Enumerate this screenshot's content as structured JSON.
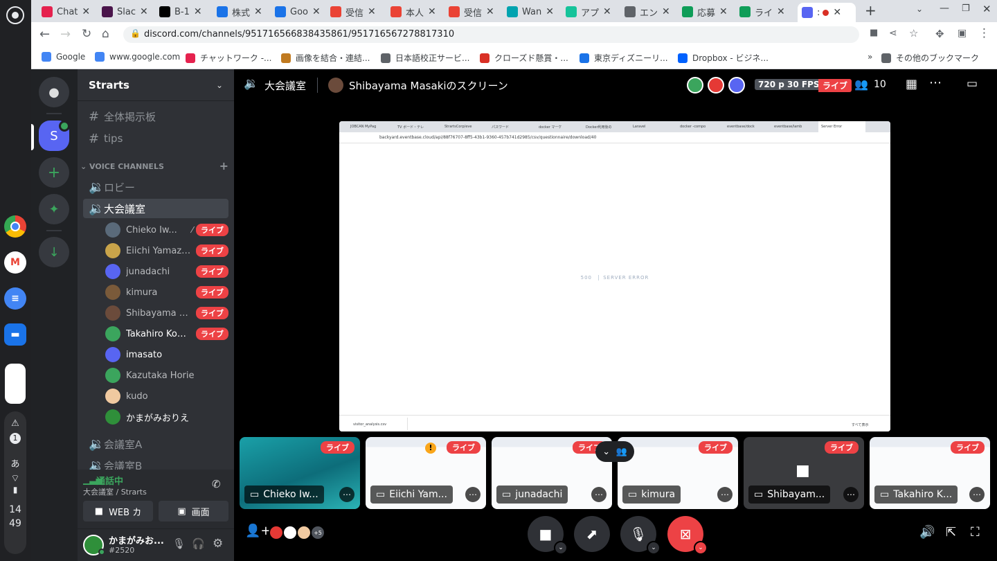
{
  "browser": {
    "tabs": [
      {
        "label": "Chat",
        "icon": "chatwork-icon",
        "color": "#e5224e"
      },
      {
        "label": "Slac",
        "icon": "slack-icon",
        "color": "#4a154b"
      },
      {
        "label": "B-1",
        "icon": "notion-icon",
        "color": "#000000"
      },
      {
        "label": "株式",
        "icon": "calendar-icon",
        "color": "#1a73e8"
      },
      {
        "label": "Goo",
        "icon": "calendar-icon",
        "color": "#1a73e8"
      },
      {
        "label": "受信",
        "icon": "gmail-icon",
        "color": "#ea4335"
      },
      {
        "label": "本人",
        "icon": "gmail-icon",
        "color": "#ea4335"
      },
      {
        "label": "受信",
        "icon": "gmail-icon",
        "color": "#ea4335"
      },
      {
        "label": "Wan",
        "icon": "w-icon",
        "color": "#00a3af"
      },
      {
        "label": "アプ",
        "icon": "grammarly-icon",
        "color": "#15c39a"
      },
      {
        "label": "エン",
        "icon": "globe-icon",
        "color": "#5f6368"
      },
      {
        "label": "応募",
        "icon": "sheets-icon",
        "color": "#0f9d58"
      },
      {
        "label": "ライ",
        "icon": "sheets-icon",
        "color": "#0f9d58"
      },
      {
        "label": ":",
        "icon": "discord-icon",
        "color": "#5865f2",
        "active": true
      }
    ],
    "url": "discord.com/channels/951716566838435861/951716567278817310",
    "bookmarks": [
      {
        "label": "Google",
        "icon": "google-icon"
      },
      {
        "label": "www.google.com",
        "icon": "google-icon"
      },
      {
        "label": "チャットワーク -...",
        "icon": "chatwork-icon"
      },
      {
        "label": "画像を結合・連結...",
        "icon": "image-icon"
      },
      {
        "label": "日本語校正サービ...",
        "icon": "globe-icon"
      },
      {
        "label": "クローズド懸賞・...",
        "icon": "prize-icon"
      },
      {
        "label": "東京ディズニーリ...",
        "icon": "disney-icon"
      },
      {
        "label": "Dropbox - ビジネ...",
        "icon": "dropbox-icon"
      }
    ],
    "other_bookmarks": "その他のブックマーク",
    "more_bookmarks": "»"
  },
  "shelf": {
    "time_hour": "14",
    "time_min": "49",
    "ime": "あ",
    "notif_count": "1"
  },
  "discord": {
    "server_name": "Strarts",
    "server_initial": "S",
    "text_channels": [
      "全体掲示板",
      "tips"
    ],
    "voice_header": "VOICE CHANNELS",
    "voice_channels": [
      {
        "name": "ロビー"
      },
      {
        "name": "大会議室",
        "active": true
      },
      {
        "name": "会議室A"
      },
      {
        "name": "会議室B"
      }
    ],
    "members": [
      {
        "name": "Chieko Iw...",
        "live": true,
        "deaf": true,
        "avatar": "#5a6a7a"
      },
      {
        "name": "Eiichi Yamazaki",
        "live": true,
        "avatar": "#c9a44a"
      },
      {
        "name": "junadachi",
        "live": true,
        "avatar": "#5865f2"
      },
      {
        "name": "kimura",
        "live": true,
        "avatar": "#7a5a3a"
      },
      {
        "name": "Shibayama M...",
        "live": true,
        "avatar": "#6b4b3b"
      },
      {
        "name": "Takahiro Kom...",
        "live": true,
        "avatar": "#3ba55d",
        "bright": true
      },
      {
        "name": "imasato",
        "live": false,
        "avatar": "#5865f2",
        "bright": true
      },
      {
        "name": "Kazutaka Horie",
        "live": false,
        "avatar": "#3ba55d"
      },
      {
        "name": "kudo",
        "live": false,
        "avatar": "#f0c9a0"
      },
      {
        "name": "かまがみおりえ",
        "live": false,
        "avatar": "#2f8f3a",
        "bright": true
      }
    ],
    "live_label": "ライブ",
    "voice_status": "通話中",
    "voice_location": "大会議室 / Strarts",
    "web_cam_label": "WEB カ",
    "screen_label": "画面",
    "user": {
      "name": "かまがみお...",
      "tag": "#2520"
    }
  },
  "stage": {
    "channel": "大会議室",
    "screen_title": "Shibayama Masakiのスクリーン",
    "quality": "720 p 30 FPS",
    "live": "ライブ",
    "participants": "10",
    "shared": {
      "url": "backyard.eventbase.cloud/api/88f76707-8ff5-43b1-9360-457b741d2985/csv/questionnaire/download/40",
      "error_code": "500",
      "error_text": "SERVER ERROR",
      "download_file": "visitor_analysis.csv",
      "show_all": "すべて表示",
      "mini_tabs": [
        "JOBCAN MyPag",
        "TV ボード・テレ",
        "StrartsCorp/eve",
        "パスワード",
        "docker マーケ",
        "Docker利用後の",
        "Laravel",
        "docker -compo",
        "eventbase/dock",
        "eventbase/lamb",
        "Server Error"
      ]
    },
    "tiles": [
      {
        "name": "Chieko Iw...",
        "live": true,
        "bg": "ocean"
      },
      {
        "name": "Eiichi Yam...",
        "live": true,
        "bg": "screen",
        "warn": true
      },
      {
        "name": "junadachi",
        "live": true,
        "bg": "screen"
      },
      {
        "name": "kimura",
        "live": true,
        "bg": "screen"
      },
      {
        "name": "Shibayam...",
        "live": true,
        "bg": "gray"
      },
      {
        "name": "Takahiro K...",
        "live": true,
        "bg": "screen"
      }
    ],
    "extra_count": "+5"
  },
  "colors": {
    "blurple": "#5865f2",
    "green": "#3ba55d",
    "red": "#ed4245",
    "bg_dark": "#202225",
    "bg_mid": "#2f3136"
  }
}
